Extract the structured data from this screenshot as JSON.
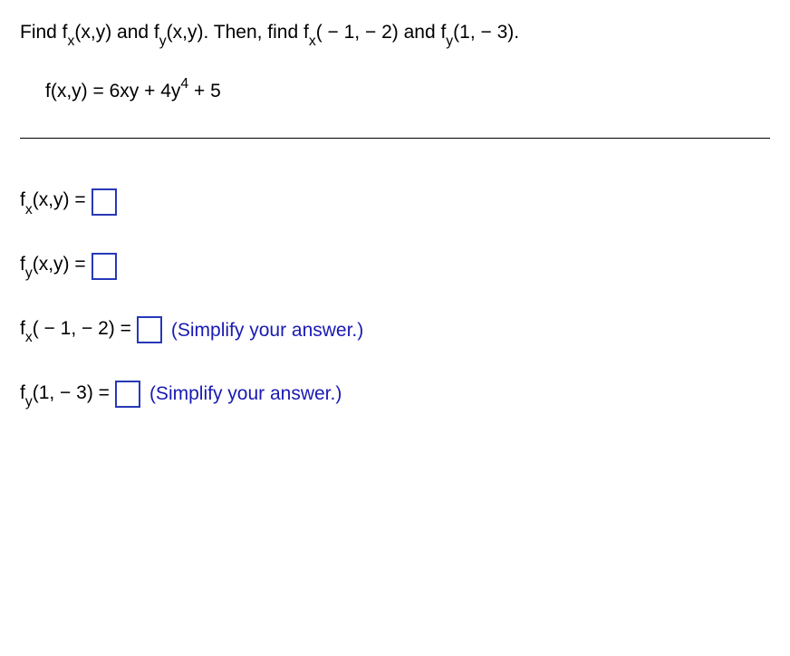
{
  "problem": {
    "instruction_part1": "Find f",
    "sub_x": "x",
    "instruction_part2": "(x,y) and f",
    "sub_y": "y",
    "instruction_part3": "(x,y). Then, find f",
    "instruction_part4": "( − 1, − 2) and f",
    "instruction_part5": "(1, − 3).",
    "equation_lhs": "f(x,y) = 6xy + 4y",
    "equation_exp": "4",
    "equation_rhs": " + 5"
  },
  "answers": {
    "line1_prefix": "f",
    "line1_sub": "x",
    "line1_args": "(x,y) = ",
    "line2_prefix": "f",
    "line2_sub": "y",
    "line2_args": "(x,y) = ",
    "line3_prefix": "f",
    "line3_sub": "x",
    "line3_args": "( − 1, − 2) = ",
    "line4_prefix": "f",
    "line4_sub": "y",
    "line4_args": "(1, − 3) = ",
    "hint": "(Simplify your answer.)"
  }
}
